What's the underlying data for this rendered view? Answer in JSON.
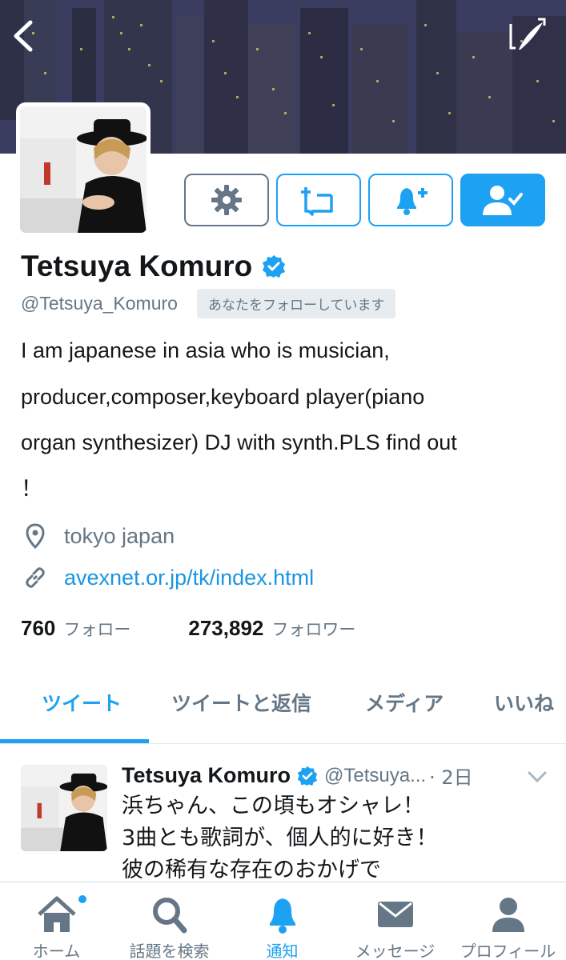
{
  "profile": {
    "name": "Tetsuya Komuro",
    "handle": "@Tetsuya_Komuro",
    "follows_you": "あなたをフォローしています",
    "bio_lines": [
      "I am japanese in asia who is musician,",
      "producer,composer,keyboard player(piano",
      "organ synthesizer) DJ with synth.PLS find out",
      "！"
    ],
    "location": "tokyo japan",
    "url": "avexnet.or.jp/tk/index.html",
    "following_count": "760",
    "following_label": "フォロー",
    "followers_count": "273,892",
    "followers_label": "フォロワー"
  },
  "tabs": [
    {
      "label": "ツイート",
      "active": true
    },
    {
      "label": "ツイートと返信",
      "active": false
    },
    {
      "label": "メディア",
      "active": false
    },
    {
      "label": "いいね",
      "active": false
    }
  ],
  "tweet": {
    "name": "Tetsuya Komuro",
    "handle": "@Tetsuya...",
    "time": "· 2日",
    "text_lines": [
      "浜ちゃん、この頃もオシャレ！",
      "3曲とも歌詞が、個人的に好き！",
      "彼の稀有な存在のおかげで"
    ]
  },
  "bottom_nav": [
    {
      "label": "ホーム",
      "icon": "home-icon"
    },
    {
      "label": "話題を検索",
      "icon": "search-icon"
    },
    {
      "label": "通知",
      "icon": "bell-icon"
    },
    {
      "label": "メッセージ",
      "icon": "envelope-icon"
    },
    {
      "label": "プロフィール",
      "icon": "person-icon"
    }
  ],
  "colors": {
    "accent": "#1da1f2",
    "text": "#14171a",
    "secondary": "#657786"
  }
}
